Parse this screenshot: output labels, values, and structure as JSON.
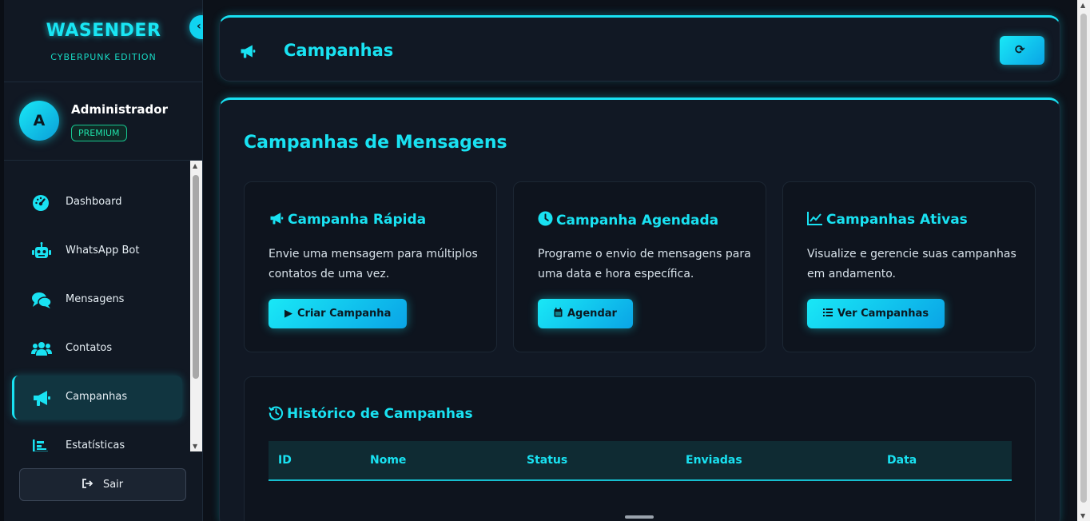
{
  "brand": {
    "title": "WASENDER",
    "subtitle": "CYBERPUNK EDITION"
  },
  "user": {
    "avatar_letter": "A",
    "name": "Administrador",
    "badge": "PREMIUM"
  },
  "sidebar": {
    "collapse_icon": "chevron-left-icon",
    "items": [
      {
        "label": "Dashboard",
        "icon": "gauge-icon",
        "active": false
      },
      {
        "label": "WhatsApp Bot",
        "icon": "robot-icon",
        "active": false
      },
      {
        "label": "Mensagens",
        "icon": "comments-icon",
        "active": false
      },
      {
        "label": "Contatos",
        "icon": "users-icon",
        "active": false
      },
      {
        "label": "Campanhas",
        "icon": "bullhorn-icon",
        "active": true
      },
      {
        "label": "Estatísticas",
        "icon": "bar-chart-icon",
        "active": false
      }
    ],
    "logout_label": "Sair"
  },
  "header": {
    "title": "Campanhas",
    "icon": "bullhorn-icon",
    "refresh_icon": "refresh-icon"
  },
  "main": {
    "section_title": "Campanhas de Mensagens",
    "cards": [
      {
        "title": "Campanha Rápida",
        "icon": "bullhorn-icon",
        "description": "Envie uma mensagem para múltiplos contatos de uma vez.",
        "button": "Criar Campanha",
        "button_icon": "play-icon"
      },
      {
        "title": "Campanha Agendada",
        "icon": "clock-icon",
        "description": "Programe o envio de mensagens para uma data e hora específica.",
        "button": "Agendar",
        "button_icon": "calendar-icon"
      },
      {
        "title": "Campanhas Ativas",
        "icon": "line-chart-icon",
        "description": "Visualize e gerencie suas campanhas em andamento.",
        "button": "Ver Campanhas",
        "button_icon": "list-icon"
      }
    ],
    "history": {
      "title": "Histórico de Campanhas",
      "icon": "history-icon",
      "columns": [
        "ID",
        "Nome",
        "Status",
        "Enviadas",
        "Data"
      ]
    }
  },
  "colors": {
    "accent": "#19e2f2",
    "background": "#0c1119",
    "card": "#111824",
    "badge": "#1fe0a8"
  }
}
